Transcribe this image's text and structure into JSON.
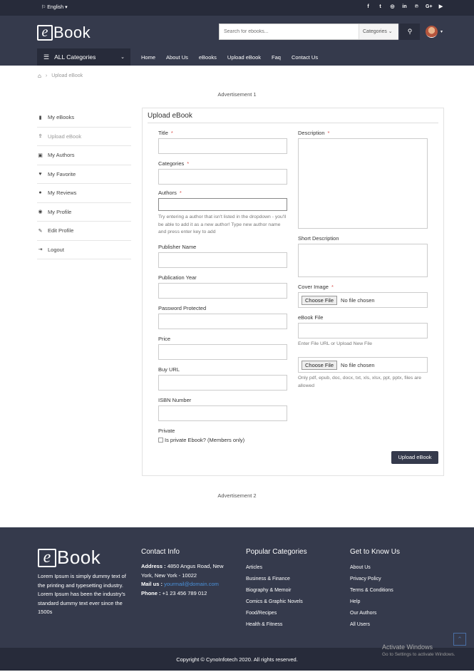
{
  "topbar": {
    "language": "English",
    "social_icons": [
      "facebook-icon",
      "twitter-icon",
      "instagram-icon",
      "linkedin-icon",
      "pinterest-icon",
      "google-plus-icon",
      "youtube-icon"
    ],
    "social_glyphs": [
      "f",
      "t",
      "◎",
      "in",
      "℗",
      "G+",
      "▶"
    ]
  },
  "header": {
    "logo_letter": "e",
    "logo_word": "Book",
    "search_placeholder": "Search for ebooks...",
    "search_category": "Categories",
    "all_categories": "ALL Categories",
    "nav": [
      "Home",
      "About Us",
      "eBooks",
      "Upload eBook",
      "Faq",
      "Contact Us"
    ]
  },
  "breadcrumb": {
    "current": "Upload eBook"
  },
  "ads": {
    "top": "Advertisement 1",
    "bottom": "Advertisement 2"
  },
  "sidebar": {
    "items": [
      {
        "label": "My eBooks",
        "icon": "book-icon",
        "glyph": "▮"
      },
      {
        "label": "Upload eBook",
        "icon": "upload-icon",
        "glyph": "⇪"
      },
      {
        "label": "My Authors",
        "icon": "user-card-icon",
        "glyph": "▣"
      },
      {
        "label": "My Favorite",
        "icon": "heart-icon",
        "glyph": "♥"
      },
      {
        "label": "My Reviews",
        "icon": "comment-icon",
        "glyph": "●"
      },
      {
        "label": "My Profile",
        "icon": "user-circle-icon",
        "glyph": "◉"
      },
      {
        "label": "Edit Profile",
        "icon": "edit-icon",
        "glyph": "✎"
      },
      {
        "label": "Logout",
        "icon": "logout-icon",
        "glyph": "⇥"
      }
    ]
  },
  "form": {
    "heading": "Upload eBook",
    "title": "Title",
    "categories": "Categories",
    "authors": "Authors",
    "authors_help": "Try entering a author that isn't listed in the dropdown - you'll be able to add it as a new author! Type new author name and press enter key to add",
    "publisher": "Publisher Name",
    "year": "Publication Year",
    "password": "Password Protected",
    "price": "Price",
    "buy_url": "Buy URL",
    "isbn": "ISBN Number",
    "private": "Private",
    "private_check": "Is private Ebook? (Members only)",
    "description": "Description",
    "short_description": "Short Description",
    "cover_image": "Cover Image",
    "choose_file": "Choose File",
    "no_file": "No file chosen",
    "ebook_file": "eBook File",
    "ebook_help": "Enter File URL or Upload New File",
    "file_types": "Only pdf, epub, doc, docx, txt, xls, xlsx, ppt, pptx, files are allowed",
    "required": "*",
    "submit": "Upload eBook"
  },
  "footer": {
    "about": "Lorem Ipsum is simply dummy text of the printing and typesetting industry. Lorem Ipsum has been the industry's standard dummy text ever since the 1500s",
    "contact_title": "Contact Info",
    "address_label": "Address :",
    "address": "4850 Angus Road, New York, New York - 10022",
    "mail_label": "Mail us :",
    "mail": "yourmail@domain.com",
    "phone_label": "Phone :",
    "phone": "+1 23 456 789 012",
    "popular_title": "Popular Categories",
    "popular": [
      "Articles",
      "Business & Finance",
      "Biography & Memoir",
      "Comics & Graphic Novels",
      "Food/Recipes",
      "Health & Fitness"
    ],
    "know_title": "Get to Know Us",
    "know": [
      "About Us",
      "Privacy Policy",
      "Terms & Conditions",
      "Help",
      "Our Authors",
      "All Users"
    ],
    "copyright": "Copyright © CynoInfotech 2020. All rights reserved.",
    "activate_title": "Activate Windows",
    "activate_sub": "Go to Settings to activate Windows."
  }
}
